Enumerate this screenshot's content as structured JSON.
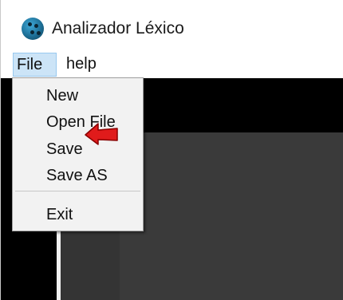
{
  "window": {
    "title": "Analizador Léxico",
    "icon": "app-globe-icon"
  },
  "menubar": {
    "file_label": "File",
    "help_label": "help"
  },
  "file_menu": {
    "items": [
      {
        "label": "New"
      },
      {
        "label": "Open File"
      },
      {
        "label": "Save"
      },
      {
        "label": "Save AS"
      },
      {
        "label": "Exit"
      }
    ]
  },
  "annotation": {
    "arrow_icon": "red-arrow-icon",
    "arrow_color": "#e01b1b"
  },
  "colors": {
    "menu_highlight": "#cce4f7",
    "content_background": "#000000",
    "editor_background": "#3a3a3a"
  }
}
